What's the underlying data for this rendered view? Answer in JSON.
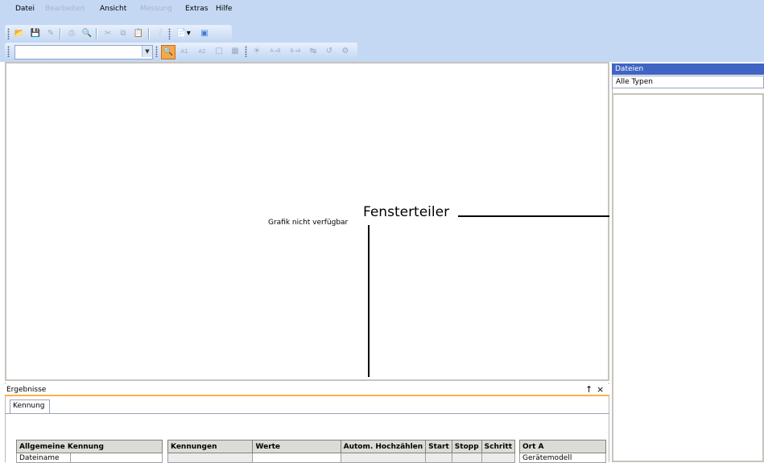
{
  "menu": {
    "datei": "Datei",
    "bearbeiten": "Bearbeiten",
    "ansicht": "Ansicht",
    "messung": "Messung",
    "extras": "Extras",
    "hilfe": "Hilfe"
  },
  "toolbar": {
    "icons": [
      "open-folder-icon",
      "save-icon",
      "edit-icon",
      "print-icon",
      "print-preview-icon",
      "cut-icon",
      "copy-icon",
      "paste-icon",
      "help-icon",
      "report-icon",
      "camera-icon"
    ],
    "marker_labels": [
      "A1",
      "A2"
    ],
    "delta_labels": [
      "A→B",
      "B→A"
    ]
  },
  "graph": {
    "message": "Grafik nicht verfügbar"
  },
  "callout": {
    "label": "Fensterteiler"
  },
  "files": {
    "header": "Dateien",
    "type_filter": "Alle Typen"
  },
  "results": {
    "title": "Ergebnisse",
    "pin": "↑",
    "close": "×",
    "tab": "Kennung",
    "general_table": {
      "header": "Allgemeine Kennung",
      "rows": [
        [
          "Dateiname",
          ""
        ]
      ]
    },
    "ids_table": {
      "headers": [
        "Kennungen",
        "Werte",
        "Autom. Hochzählen",
        "Start",
        "Stopp",
        "Schritt"
      ]
    },
    "location_table": {
      "header": "Ort A",
      "rows": [
        "Gerätemodell"
      ]
    }
  },
  "colors": {
    "chrome": "#c4d8f4",
    "files_header": "#3f64c3",
    "results_accent": "#ffb04a"
  }
}
